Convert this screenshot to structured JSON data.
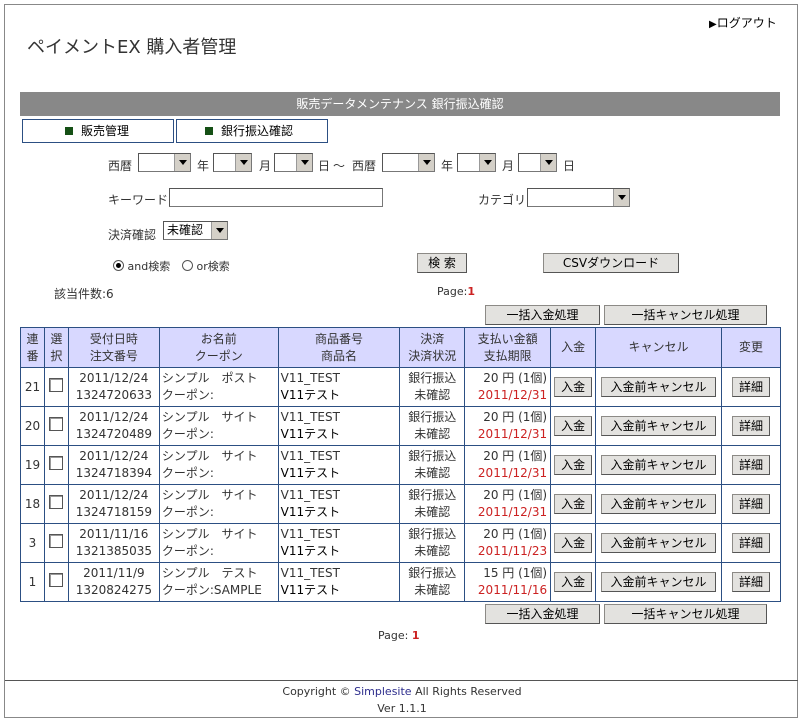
{
  "header": {
    "logout": "ログアウト",
    "title": "ペイメントEX 購入者管理"
  },
  "section_title": "販売データメンテナンス 銀行振込確認",
  "tabs": [
    {
      "label": "販売管理"
    },
    {
      "label": "銀行振込確認"
    }
  ],
  "filters": {
    "seireki": "西暦",
    "year": "年",
    "month": "月",
    "day": "日",
    "tilde": "～",
    "keyword_label": "キーワード",
    "category_label": "カテゴリ",
    "settlement_label": "決済確認",
    "settlement_value": "未確認",
    "and_search": "and検索",
    "or_search": "or検索",
    "search_button": "検 索",
    "csv_button": "CSVダウンロード"
  },
  "count": {
    "label": "該当件数:",
    "value": "6"
  },
  "pager": {
    "label": "Page:",
    "value": "1"
  },
  "bulk": {
    "deposit": "一括入金処理",
    "cancel": "一括キャンセル処理"
  },
  "table": {
    "headers": [
      {
        "l1": "連",
        "l2": "番"
      },
      {
        "l1": "選",
        "l2": "択"
      },
      {
        "l1": "受付日時",
        "l2": "注文番号"
      },
      {
        "l1": "お名前",
        "l2": "クーポン"
      },
      {
        "l1": "商品番号",
        "l2": "商品名"
      },
      {
        "l1": "決済",
        "l2": "決済状況"
      },
      {
        "l1": "支払い金額",
        "l2": "支払期限"
      },
      {
        "l1": "入金",
        "l2": ""
      },
      {
        "l1": "キャンセル",
        "l2": ""
      },
      {
        "l1": "変更",
        "l2": ""
      }
    ],
    "rows": [
      {
        "no": "21",
        "date": "2011/12/24",
        "order": "1324720633",
        "name": "シンプル　ポスト",
        "coupon": "クーポン:",
        "code": "V11_TEST",
        "product": "V11テスト",
        "method": "銀行振込",
        "status": "未確認",
        "amount": "20 円 (1個)",
        "deadline": "2011/12/31"
      },
      {
        "no": "20",
        "date": "2011/12/24",
        "order": "1324720489",
        "name": "シンプル　サイト",
        "coupon": "クーポン:",
        "code": "V11_TEST",
        "product": "V11テスト",
        "method": "銀行振込",
        "status": "未確認",
        "amount": "20 円 (1個)",
        "deadline": "2011/12/31"
      },
      {
        "no": "19",
        "date": "2011/12/24",
        "order": "1324718394",
        "name": "シンプル　サイト",
        "coupon": "クーポン:",
        "code": "V11_TEST",
        "product": "V11テスト",
        "method": "銀行振込",
        "status": "未確認",
        "amount": "20 円 (1個)",
        "deadline": "2011/12/31"
      },
      {
        "no": "18",
        "date": "2011/12/24",
        "order": "1324718159",
        "name": "シンプル　サイト",
        "coupon": "クーポン:",
        "code": "V11_TEST",
        "product": "V11テスト",
        "method": "銀行振込",
        "status": "未確認",
        "amount": "20 円 (1個)",
        "deadline": "2011/12/31"
      },
      {
        "no": "3",
        "date": "2011/11/16",
        "order": "1321385035",
        "name": "シンプル　サイト",
        "coupon": "クーポン:",
        "code": "V11_TEST",
        "product": "V11テスト",
        "method": "銀行振込",
        "status": "未確認",
        "amount": "20 円 (1個)",
        "deadline": "2011/11/23"
      },
      {
        "no": "1",
        "date": "2011/11/9",
        "order": "1320824275",
        "name": "シンプル　テスト",
        "coupon": "クーポン:SAMPLE",
        "code": "V11_TEST",
        "product": "V11テスト",
        "method": "銀行振込",
        "status": "未確認",
        "amount": "15 円 (1個)",
        "deadline": "2011/11/16"
      }
    ],
    "row_buttons": {
      "deposit": "入金",
      "cancel": "入金前キャンセル",
      "detail": "詳細"
    }
  },
  "footer": {
    "copyright_prefix": "Copyright © ",
    "company": "Simplesite",
    "rights": " All Rights Reserved",
    "version": "Ver 1.1.1"
  },
  "colors": {
    "accent_red": "#cc2222",
    "header_bar": "#888888",
    "table_header": "#d8d8ff",
    "border_blue": "#2c4f83"
  }
}
